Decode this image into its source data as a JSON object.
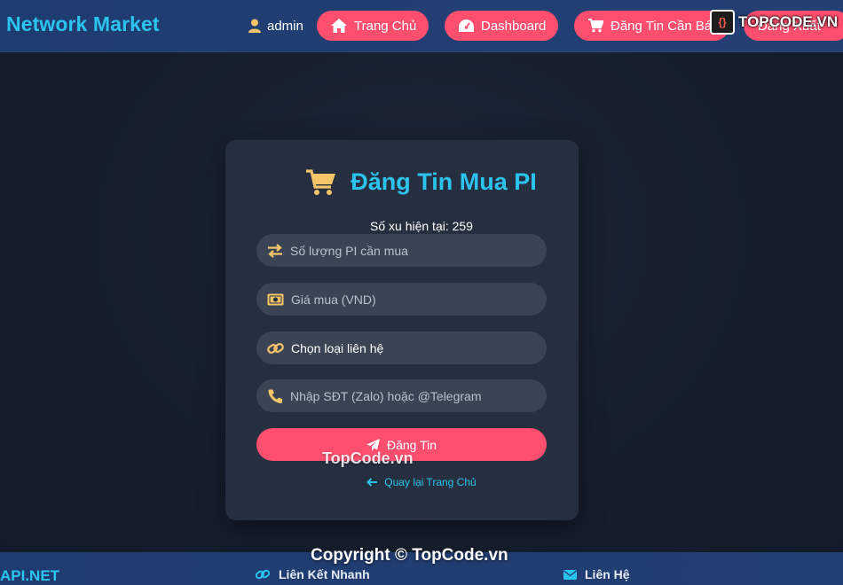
{
  "header": {
    "brand": "Network Market",
    "user": "admin",
    "nav": {
      "home": "Trang Chủ",
      "dashboard": "Dashboard",
      "post": "Đăng Tin Cần Bán",
      "logout": "Đăng Xuất"
    }
  },
  "watermark": {
    "logo_text": "TOPCODE.VN",
    "mid_text": "TopCode.vn",
    "copyright": "Copyright © TopCode.vn"
  },
  "form": {
    "title": "Đăng Tin Mua PI",
    "coins_label": "Số xu hiện tại: 259",
    "fields": {
      "quantity_placeholder": "Số lượng PI cần mua",
      "price_placeholder": "Giá mua (VND)",
      "contact_type": "Chọn loại liên hệ",
      "contact_placeholder": "Nhập SĐT (Zalo) hoặc @Telegram"
    },
    "submit_label": "Đăng Tin",
    "back_label": "Quay lại Trang Chủ"
  },
  "footer": {
    "brand": "API.NET",
    "quick_links": "Liên Kết Nhanh",
    "contact": "Liên Hệ"
  },
  "colors": {
    "accent": "#2bc4ef",
    "button": "#ff4e6e",
    "icon": "#f6c56a",
    "card": "#262f3f",
    "header": "#223f74"
  }
}
